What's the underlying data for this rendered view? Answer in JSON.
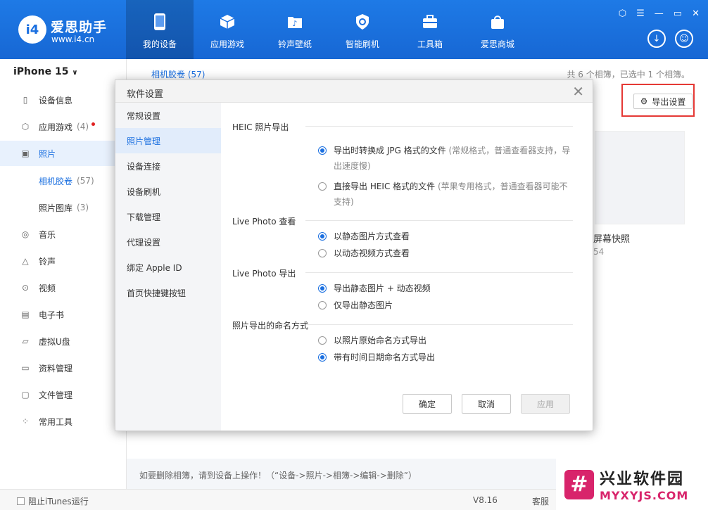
{
  "app": {
    "logo_text": "i4",
    "name": "爱思助手",
    "url": "www.i4.cn"
  },
  "nav": [
    {
      "label": "我的设备",
      "icon": "phone-icon"
    },
    {
      "label": "应用游戏",
      "icon": "cube-icon"
    },
    {
      "label": "铃声壁纸",
      "icon": "music-folder-icon"
    },
    {
      "label": "智能刷机",
      "icon": "shield-refresh-icon"
    },
    {
      "label": "工具箱",
      "icon": "toolbox-icon"
    },
    {
      "label": "爱思商城",
      "icon": "shopping-bag-icon"
    }
  ],
  "window_controls": [
    "skin-icon",
    "menu-icon",
    "minimize-icon",
    "maximize-icon",
    "close-icon"
  ],
  "sidebar": {
    "device": "iPhone 15",
    "items": [
      {
        "label": "设备信息",
        "icon": "phone-outline-icon"
      },
      {
        "label": "应用游戏",
        "count": "(4)",
        "icon": "cube-outline-icon"
      },
      {
        "label": "照片",
        "icon": "image-icon"
      },
      {
        "label": "音乐",
        "icon": "disc-icon"
      },
      {
        "label": "铃声",
        "icon": "bell-icon"
      },
      {
        "label": "视频",
        "icon": "play-icon"
      },
      {
        "label": "电子书",
        "icon": "book-icon"
      },
      {
        "label": "虚拟U盘",
        "icon": "usb-icon"
      },
      {
        "label": "资料管理",
        "icon": "document-icon"
      },
      {
        "label": "文件管理",
        "icon": "folder-icon"
      },
      {
        "label": "常用工具",
        "icon": "grid-icon"
      }
    ],
    "sub_items": [
      {
        "label": "相机胶卷",
        "count": "(57)"
      },
      {
        "label": "照片图库",
        "count": "(3)"
      }
    ]
  },
  "main": {
    "breadcrumb": "相机胶卷 (57)",
    "summary": "共 6 个相簿，已选中 1 个相簿。",
    "export_button": "导出设置",
    "thumb_label": "屏幕快照",
    "thumb_count": "54",
    "footer_hint": "如要删除相簿，请到设备上操作！（“设备->照片->相簿->编辑->删除”）"
  },
  "bottom": {
    "itunes": "阻止iTunes运行",
    "version": "V8.16",
    "service": "客服"
  },
  "watermark": {
    "title": "兴业软件园",
    "url": "MYXYJS.COM"
  },
  "dialog": {
    "title": "软件设置",
    "nav": [
      "常规设置",
      "照片管理",
      "设备连接",
      "设备刷机",
      "下载管理",
      "代理设置",
      "绑定 Apple ID",
      "首页快捷键按钮"
    ],
    "sections": {
      "heic": {
        "title": "HEIC 照片导出",
        "opt1": "导出时转换成 JPG 格式的文件",
        "opt1_note": "(常规格式，普通查看器支持，导出速度慢)",
        "opt2": "直接导出 HEIC 格式的文件",
        "opt2_note": "(苹果专用格式，普通查看器可能不支持)"
      },
      "live_view": {
        "title": "Live Photo 查看",
        "opt1": "以静态图片方式查看",
        "opt2": "以动态视频方式查看"
      },
      "live_export": {
        "title": "Live Photo 导出",
        "opt1": "导出静态图片 + 动态视频",
        "opt2": "仅导出静态图片"
      },
      "naming": {
        "title": "照片导出的命名方式",
        "opt1": "以照片原始命名方式导出",
        "opt2": "带有时间日期命名方式导出"
      }
    },
    "buttons": {
      "ok": "确定",
      "cancel": "取消",
      "apply": "应用"
    }
  }
}
